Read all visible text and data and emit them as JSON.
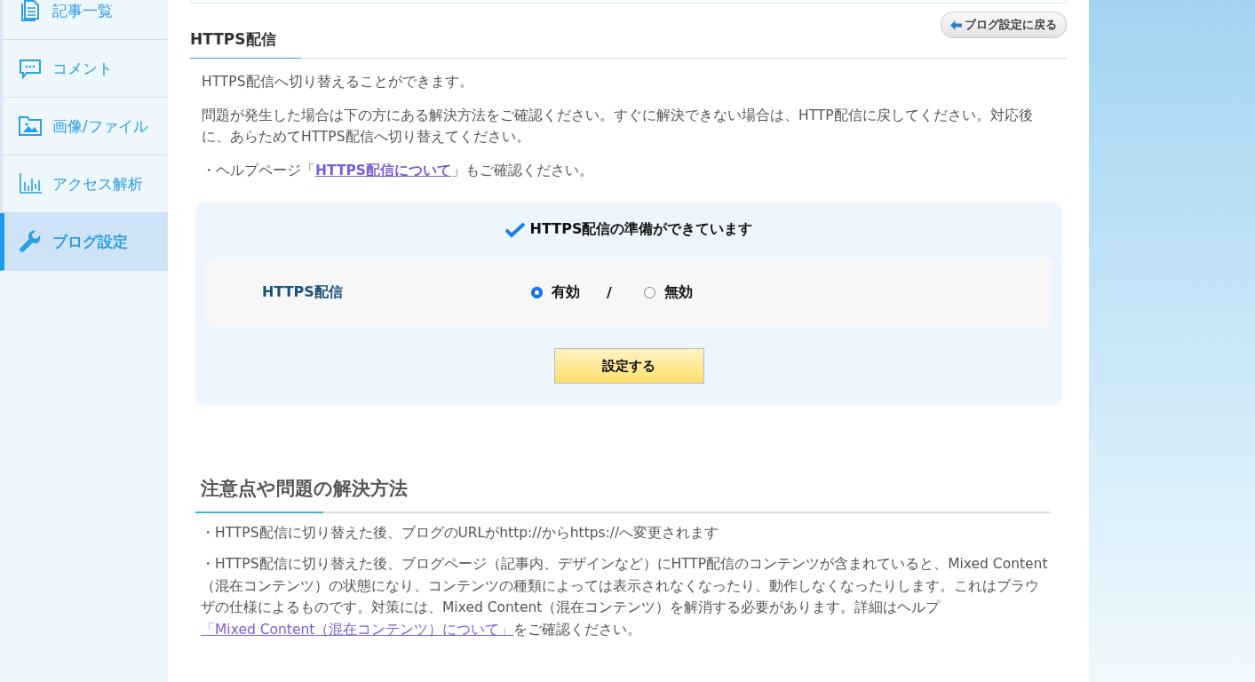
{
  "sidebar": {
    "items": [
      {
        "label": "記事一覧",
        "kind": "articles",
        "selected": false
      },
      {
        "label": "コメント",
        "kind": "comment",
        "selected": false
      },
      {
        "label": "画像/ファイル",
        "kind": "image",
        "selected": false
      },
      {
        "label": "アクセス解析",
        "kind": "chart",
        "selected": false
      },
      {
        "label": "ブログ設定",
        "kind": "wrench",
        "selected": true
      }
    ]
  },
  "back_button": "ブログ設定に戻る",
  "heading": "HTTPS配信",
  "intro": [
    "HTTPS配信へ切り替えることができます。",
    "問題が発生した場合は下の方にある解決方法をご確認ください。すぐに解決できない場合は、HTTP配信に戻してください。対応後に、あらためてHTTPS配信へ切り替えてください。"
  ],
  "help": {
    "before": "・ヘルプページ「",
    "link": "HTTPS配信について",
    "after": "」もご確認ください。"
  },
  "panel": {
    "status": "HTTPS配信の準備ができています",
    "setting_label": "HTTPS配信",
    "separator": "/",
    "options": [
      {
        "label": "有効",
        "selected": true
      },
      {
        "label": "無効",
        "selected": false
      }
    ],
    "submit": "設定する"
  },
  "notes": {
    "heading": "注意点や問題の解決方法",
    "items": [
      {
        "text": "・HTTPS配信に切り替えた後、ブログのURLがhttp://からhttps://へ変更されます"
      },
      {
        "text": "・HTTPS配信に切り替えた後、ブログページ（記事内、デザインなど）にHTTP配信のコンテンツが含まれていると、Mixed Content（混在コンテンツ）の状態になり、コンテンツの種類によっては表示されなくなったり、動作しなくなったりします。これはブラウザの仕様によるものです。対策には、Mixed Content（混在コンテンツ）を解消する必要があります。詳細はヘルプ",
        "link": "「Mixed Content（混在コンテンツ）について」",
        "after": "をご確認ください。"
      }
    ]
  }
}
